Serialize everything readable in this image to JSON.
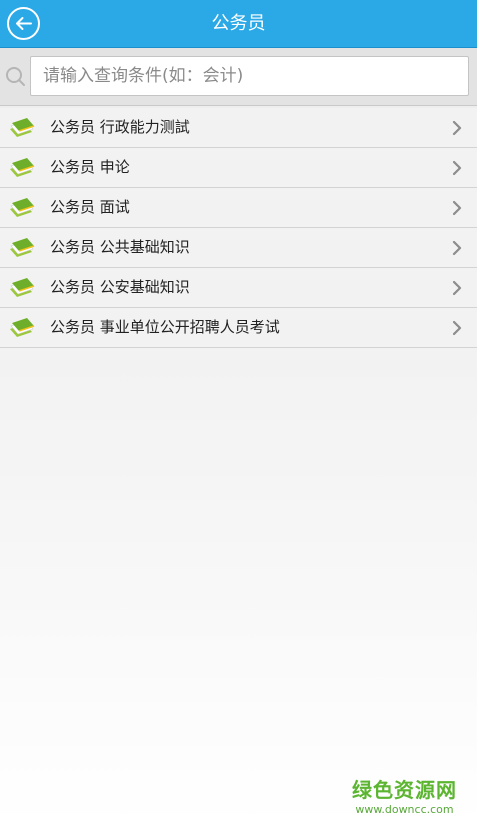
{
  "header": {
    "title": "公务员"
  },
  "search": {
    "placeholder": "请输入查询条件(如：会计)"
  },
  "list": {
    "items": [
      {
        "label": "公务员 行政能力测試"
      },
      {
        "label": "公务员 申论"
      },
      {
        "label": "公务员 面试"
      },
      {
        "label": "公务员 公共基础知识"
      },
      {
        "label": "公务员 公安基础知识"
      },
      {
        "label": "公务员 事业单位公开招聘人员考试"
      }
    ]
  },
  "watermark": {
    "main": "绿色资源网",
    "sub": "www.downcc.com"
  },
  "icons": {
    "back": "back-arrow-icon",
    "search": "magnifier-icon",
    "item": "books-icon",
    "chevron": "chevron-right-icon"
  },
  "colors": {
    "header": "#2ba8e6",
    "watermark": "#5cb531"
  }
}
